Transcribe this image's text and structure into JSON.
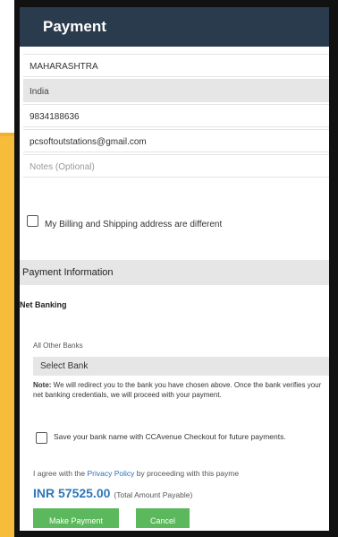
{
  "header": {
    "title": "Payment"
  },
  "billing": {
    "state": "MAHARASHTRA",
    "country": "India",
    "phone": "9834188636",
    "email": "pcsoftoutstations@gmail.com",
    "notes_placeholder": "Notes (Optional)"
  },
  "address_toggle": {
    "label": "My Billing and Shipping address are different",
    "checked": false
  },
  "payment": {
    "section_title": "Payment Information",
    "method": "Net Banking",
    "banks_label": "All Other Banks",
    "bank_select": "Select Bank",
    "note_label": "Note:",
    "note_text": " We will redirect you to the bank you have chosen above. Once the bank verifies your net banking credentials, we will proceed with your payment.",
    "save_label": "Save your bank name with CCAvenue Checkout for future payments.",
    "agree_prefix": "I agree with the ",
    "agree_link": "Privacy Policy",
    "agree_suffix": " by proceeding with this payme",
    "amount": "INR 57525.00",
    "amount_note": "(Total Amount Payable)",
    "pay_button": "Make Payment",
    "cancel_button": "Cancel"
  },
  "colors": {
    "header_bg": "#2b3b4e",
    "accent_yellow": "#f6bd3b",
    "button_green": "#5cb85c",
    "amount_blue": "#2e78b8",
    "link_blue": "#2d6fb7"
  }
}
